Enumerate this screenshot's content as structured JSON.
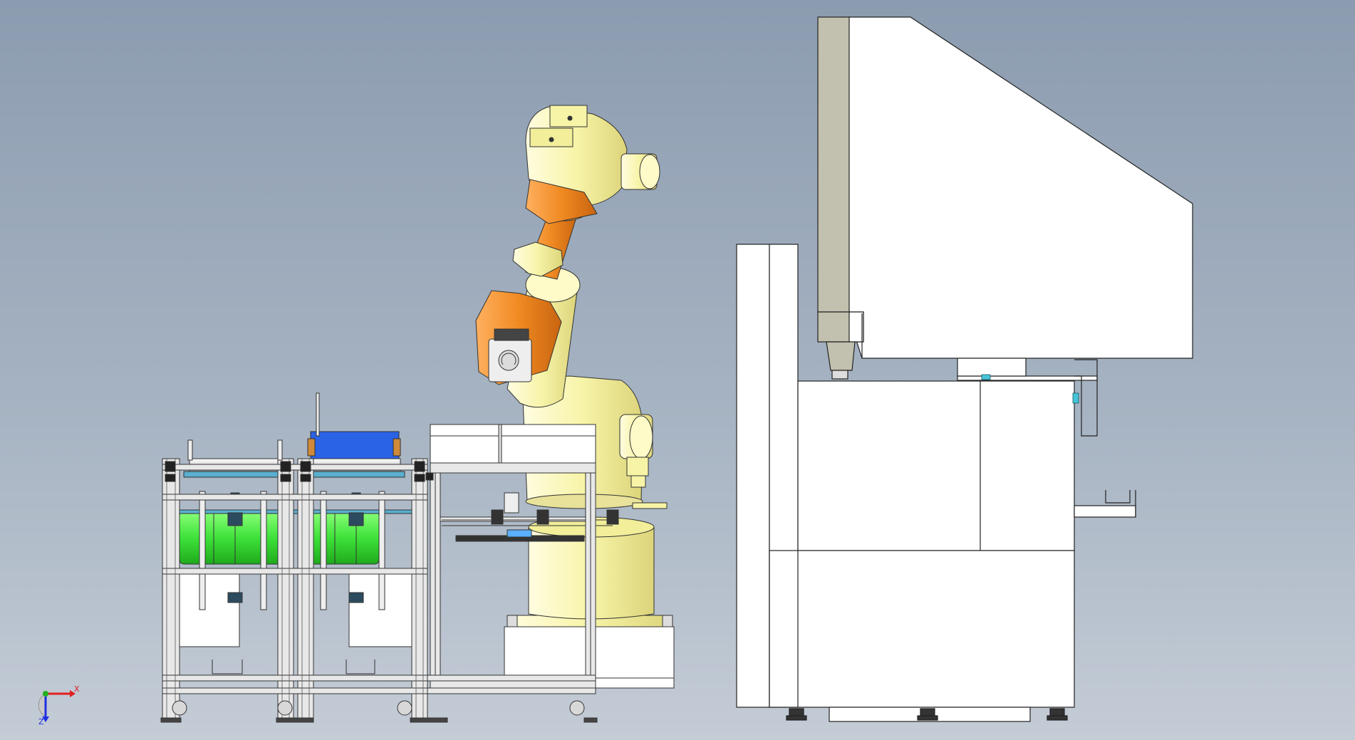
{
  "viewport": {
    "background_top": "#8c9cb0",
    "background_bottom": "#c4ccd6"
  },
  "colors": {
    "robot_yellow": "#f7f4a8",
    "robot_orange": "#f08a22",
    "gripper_green": "#3ee23a",
    "plate_blue": "#2a63e6",
    "frame_gray": "#e8e8e8",
    "machine_white": "#ffffff",
    "door_gray": "#c2c0ae"
  },
  "triad": {
    "icon": "coordinate-triad-icon",
    "x_label": "X",
    "z_label": "Z",
    "x_color": "#e02020",
    "y_color": "#20b020",
    "z_color": "#2030e0"
  }
}
